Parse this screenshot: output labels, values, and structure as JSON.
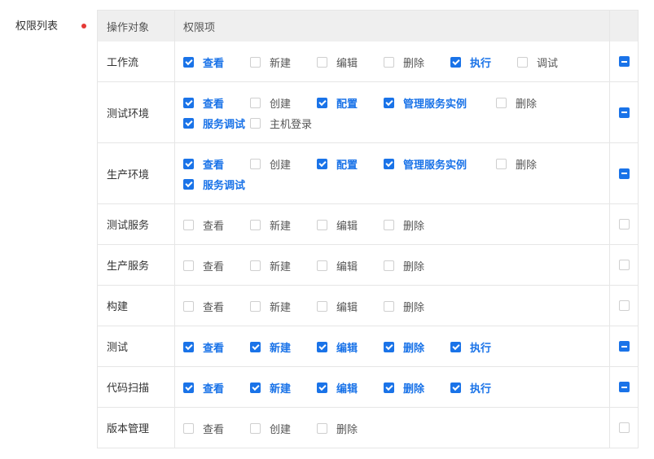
{
  "form_label": "权限列表",
  "colors": {
    "accent": "#1a73e8",
    "required": "#e53935"
  },
  "header": {
    "object_col": "操作对象",
    "perm_col": "权限项"
  },
  "rows": [
    {
      "object": "工作流",
      "all": "partial",
      "perms": [
        {
          "label": "查看",
          "checked": true
        },
        {
          "label": "新建",
          "checked": false
        },
        {
          "label": "编辑",
          "checked": false
        },
        {
          "label": "删除",
          "checked": false
        },
        {
          "label": "执行",
          "checked": true
        },
        {
          "label": "调试",
          "checked": false
        }
      ]
    },
    {
      "object": "测试环境",
      "all": "partial",
      "perms": [
        {
          "label": "查看",
          "checked": true
        },
        {
          "label": "创建",
          "checked": false
        },
        {
          "label": "配置",
          "checked": true
        },
        {
          "label": "管理服务实例",
          "checked": true
        },
        {
          "label": "删除",
          "checked": false
        },
        {
          "label": "服务调试",
          "checked": true
        },
        {
          "label": "主机登录",
          "checked": false
        }
      ]
    },
    {
      "object": "生产环境",
      "all": "partial",
      "perms": [
        {
          "label": "查看",
          "checked": true
        },
        {
          "label": "创建",
          "checked": false
        },
        {
          "label": "配置",
          "checked": true
        },
        {
          "label": "管理服务实例",
          "checked": true
        },
        {
          "label": "删除",
          "checked": false
        },
        {
          "label": "服务调试",
          "checked": true
        }
      ]
    },
    {
      "object": "测试服务",
      "all": "none",
      "perms": [
        {
          "label": "查看",
          "checked": false
        },
        {
          "label": "新建",
          "checked": false
        },
        {
          "label": "编辑",
          "checked": false
        },
        {
          "label": "删除",
          "checked": false
        }
      ]
    },
    {
      "object": "生产服务",
      "all": "none",
      "perms": [
        {
          "label": "查看",
          "checked": false
        },
        {
          "label": "新建",
          "checked": false
        },
        {
          "label": "编辑",
          "checked": false
        },
        {
          "label": "删除",
          "checked": false
        }
      ]
    },
    {
      "object": "构建",
      "all": "none",
      "perms": [
        {
          "label": "查看",
          "checked": false
        },
        {
          "label": "新建",
          "checked": false
        },
        {
          "label": "编辑",
          "checked": false
        },
        {
          "label": "删除",
          "checked": false
        }
      ]
    },
    {
      "object": "测试",
      "all": "partial",
      "perms": [
        {
          "label": "查看",
          "checked": true
        },
        {
          "label": "新建",
          "checked": true
        },
        {
          "label": "编辑",
          "checked": true
        },
        {
          "label": "删除",
          "checked": true
        },
        {
          "label": "执行",
          "checked": true
        }
      ]
    },
    {
      "object": "代码扫描",
      "all": "partial",
      "perms": [
        {
          "label": "查看",
          "checked": true
        },
        {
          "label": "新建",
          "checked": true
        },
        {
          "label": "编辑",
          "checked": true
        },
        {
          "label": "删除",
          "checked": true
        },
        {
          "label": "执行",
          "checked": true
        }
      ]
    },
    {
      "object": "版本管理",
      "all": "none",
      "perms": [
        {
          "label": "查看",
          "checked": false
        },
        {
          "label": "创建",
          "checked": false
        },
        {
          "label": "删除",
          "checked": false
        }
      ]
    }
  ]
}
